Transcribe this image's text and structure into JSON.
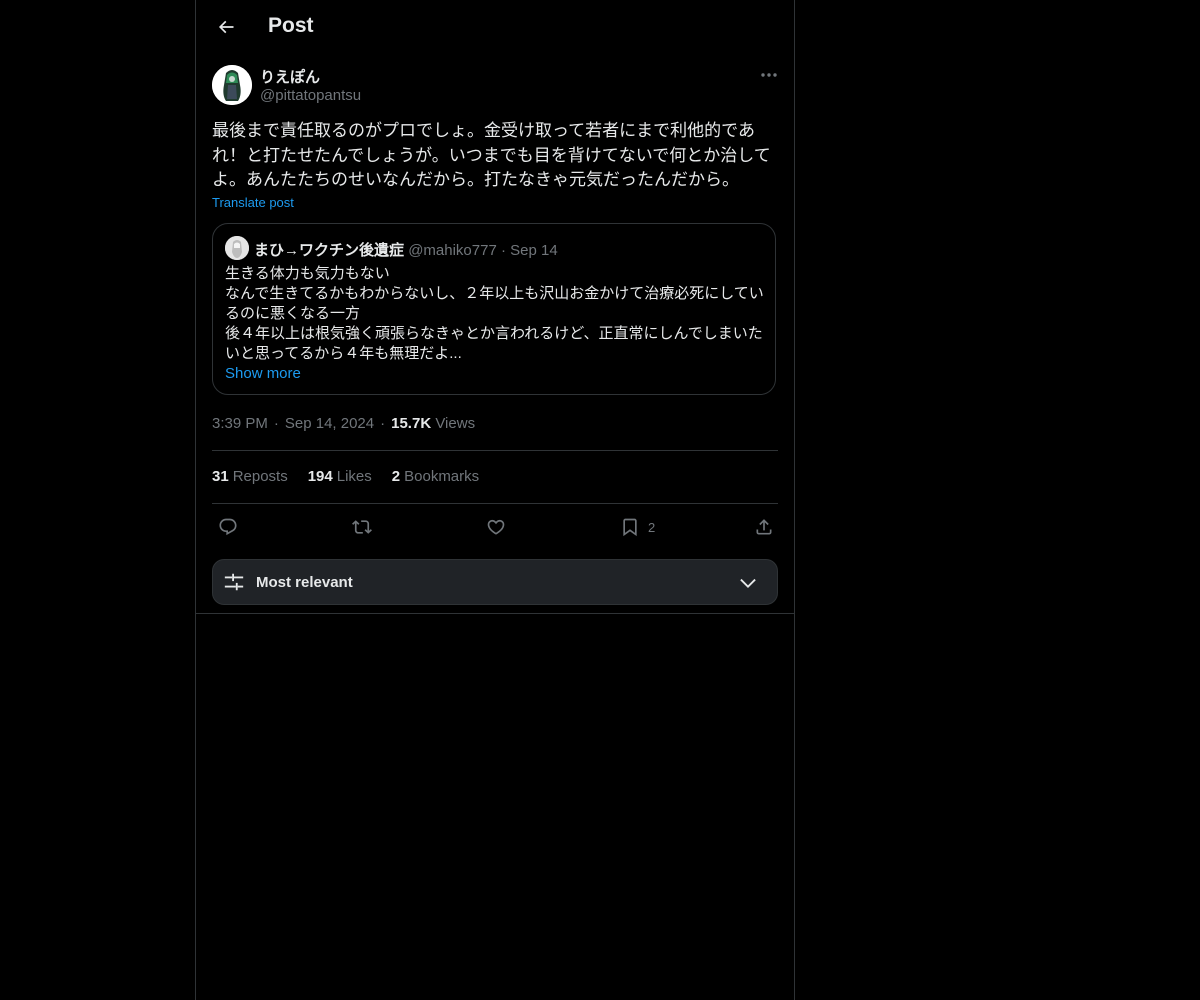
{
  "header": {
    "title": "Post",
    "back_icon": "arrow-left-icon"
  },
  "post": {
    "author_name": "りえぽん",
    "author_handle": "@pittatopantsu",
    "text": "最後まで責任取るのがプロでしょ。金受け取って若者にまで利他的であれ！と打たせたんでしょうが。いつまでも目を背けてないで何とか治してよ。あんたたちのせいなんだから。打たなきゃ元気だったんだから。",
    "translate_label": "Translate post",
    "time": "3:39 PM",
    "date": "Sep 14, 2024",
    "views_count": "15.7K",
    "views_label": "Views"
  },
  "quote": {
    "author_name": "まひ→ワクチン後遺症",
    "author_handle": "@mahiko777",
    "separator": "·",
    "date": "Sep 14",
    "lines": [
      "生きる体力も気力もない",
      "なんで生きてるかもわからないし、２年以上も沢山お金かけて治療必死にしてい",
      "るのに悪くなる一方",
      "後４年以上は根気強く頑張らなきゃとか言われるけど、正直常にしんでしまいた",
      "いと思ってるから４年も無理だよ..."
    ],
    "show_more": "Show more"
  },
  "stats": {
    "reposts_count": "31",
    "reposts_label": "Reposts",
    "likes_count": "194",
    "likes_label": "Likes",
    "bookmarks_count": "2",
    "bookmarks_label": "Bookmarks"
  },
  "actions": {
    "reply_icon": "reply-icon",
    "repost_icon": "repost-icon",
    "like_icon": "heart-icon",
    "bookmark_icon": "bookmark-icon",
    "bookmark_count": "2",
    "share_icon": "share-icon"
  },
  "sort": {
    "label": "Most relevant",
    "icon": "sliders-icon"
  },
  "colors": {
    "background": "#000000",
    "text": "#e7e9ea",
    "muted": "#71767b",
    "link": "#1d9bf0",
    "border": "#2f3336",
    "sort_bar": "#202327"
  }
}
